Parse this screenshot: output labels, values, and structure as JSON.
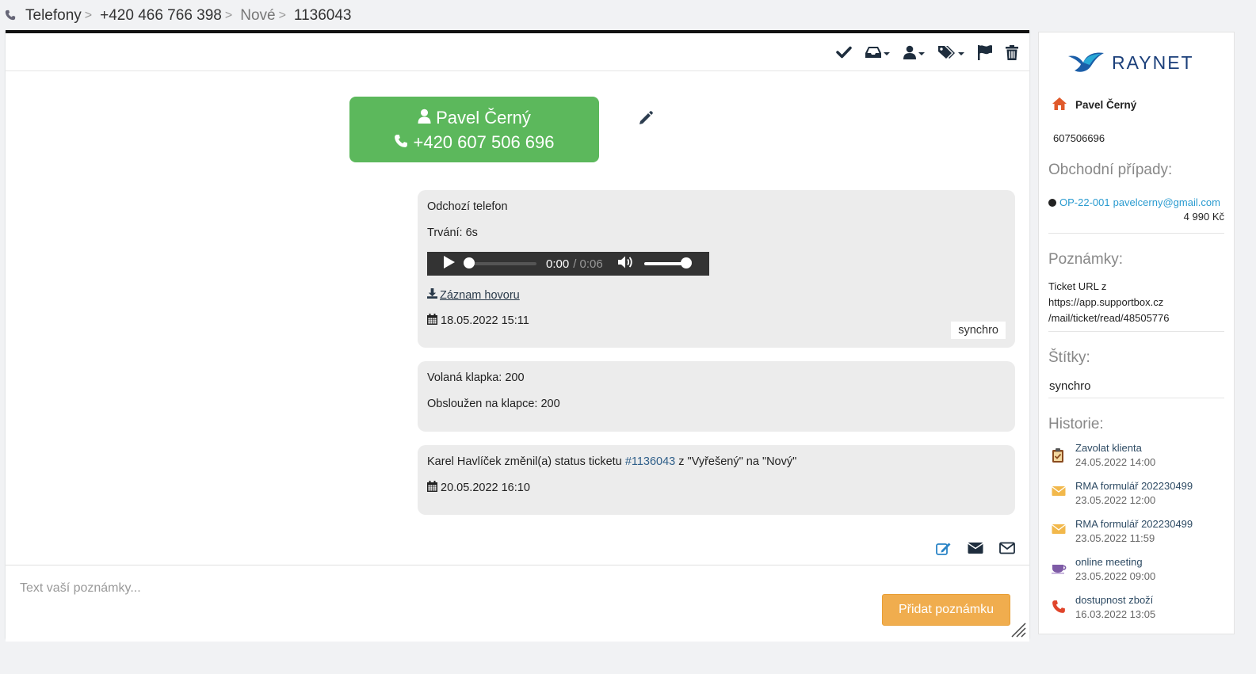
{
  "breadcrumb": {
    "items": [
      "Telefony",
      "+420 466 766 398",
      "Nové",
      "1136043"
    ],
    "separator": ">"
  },
  "toolbar": {
    "icons": [
      "check-icon",
      "inbox-icon",
      "user-icon",
      "tags-icon",
      "flag-icon",
      "trash-icon"
    ]
  },
  "contact": {
    "name": "Pavel Černý",
    "phone": "+420 607 506 696"
  },
  "messages": {
    "call": {
      "title": "Odchozí telefon",
      "duration": "Trvání: 6s",
      "audio_current": "0:00",
      "audio_total": "/ 0:06",
      "download_label": "Záznam hovoru",
      "date": "18.05.2022 15:11",
      "tag": "synchro"
    },
    "extension": {
      "called": "Volaná klapka: 200",
      "served": "Obsloužen na klapce: 200"
    },
    "status": {
      "prefix": "Karel Havlíček změnil(a) status ticketu ",
      "ticket_link": "#1136043",
      "suffix": " z \"Vyřešený\" na \"Nový\"",
      "date": "20.05.2022 16:10"
    }
  },
  "note": {
    "placeholder": "Text vaší poznámky...",
    "submit_label": "Přidat poznámku"
  },
  "sidebar": {
    "logo_text": "RAYNET",
    "person_name": "Pavel Černý",
    "phone": "607506696",
    "deals_title": "Obchodní případy:",
    "deal_code": "OP-22-001",
    "deal_email": "pavelcerny@gmail.com",
    "deal_price": "4 990 Kč",
    "notes_title": "Poznámky:",
    "note_lines": [
      "Ticket URL z",
      "https://app.supportbox.cz",
      "/mail/ticket/read/48505776"
    ],
    "tags_title": "Štítky:",
    "tag": "synchro",
    "history_title": "Historie:",
    "history": [
      {
        "title": "Zavolat klienta",
        "date": "24.05.2022 14:00",
        "icon": "task-icon"
      },
      {
        "title": "RMA formulář 202230499",
        "date": "23.05.2022 12:00",
        "icon": "envelope-icon"
      },
      {
        "title": "RMA formulář 202230499",
        "date": "23.05.2022 11:59",
        "icon": "envelope-icon"
      },
      {
        "title": "online meeting",
        "date": "23.05.2022 09:00",
        "icon": "coffee-icon"
      },
      {
        "title": "dostupnost zboží",
        "date": "16.03.2022 13:05",
        "icon": "phone-call-icon"
      }
    ]
  },
  "colors": {
    "contact_green": "#5cb85c",
    "submit_orange": "#f0ad4e",
    "link_blue": "#2a9bd0"
  }
}
